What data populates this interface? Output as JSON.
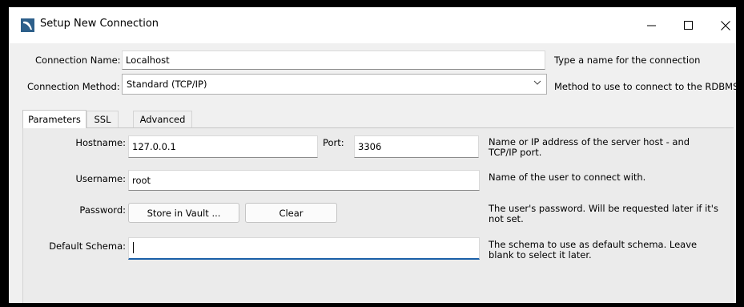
{
  "window": {
    "title": "Setup New Connection",
    "controls": [
      "minimize",
      "maximize",
      "close"
    ]
  },
  "connection": {
    "name_label": "Connection Name:",
    "name_value": "Localhost",
    "name_help": "Type a name for the connection",
    "method_label": "Connection Method:",
    "method_value": "Standard (TCP/IP)",
    "method_help": "Method to use to connect to the RDBMS"
  },
  "tabs": [
    {
      "label": "Parameters",
      "active": true
    },
    {
      "label": "SSL",
      "active": false
    },
    {
      "label": "Advanced",
      "active": false
    }
  ],
  "parameters": {
    "hostname_label": "Hostname:",
    "hostname_value": "127.0.0.1",
    "port_label": "Port:",
    "port_value": "3306",
    "hostname_help": "Name or IP address of the server host - and TCP/IP port.",
    "username_label": "Username:",
    "username_value": "root",
    "username_help": "Name of the user to connect with.",
    "password_label": "Password:",
    "store_vault_label": "Store in Vault ...",
    "clear_label": "Clear",
    "password_help": "The user's password. Will be requested later if it's not set.",
    "schema_label": "Default Schema:",
    "schema_value": "",
    "schema_help": "The schema to use as default schema. Leave blank to select it later."
  },
  "colors": {
    "accent": "#1a5fa8",
    "panel_bg": "#ebebeb",
    "dialog_bg": "#f0f0f0"
  }
}
